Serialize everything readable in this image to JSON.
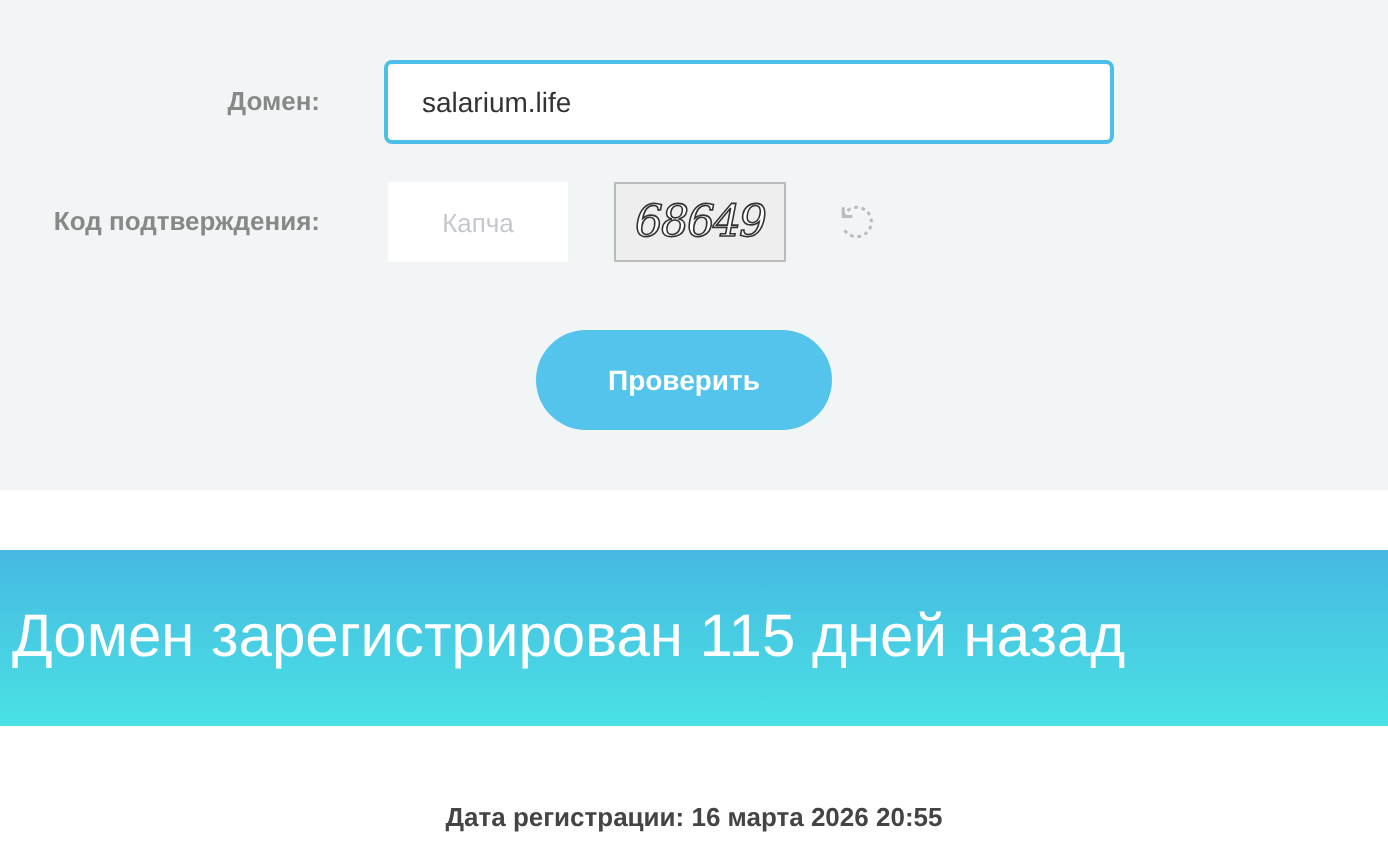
{
  "form": {
    "domain_label": "Домен:",
    "domain_value": "salarium.life",
    "captcha_label": "Код подтверждения:",
    "captcha_placeholder": "Капча",
    "captcha_code": "68649",
    "submit": "Проверить"
  },
  "result": {
    "headline": "Домен зарегистрирован 115 дней назад",
    "registration_date": "Дата регистрации: 16 марта 2026 20:55"
  }
}
